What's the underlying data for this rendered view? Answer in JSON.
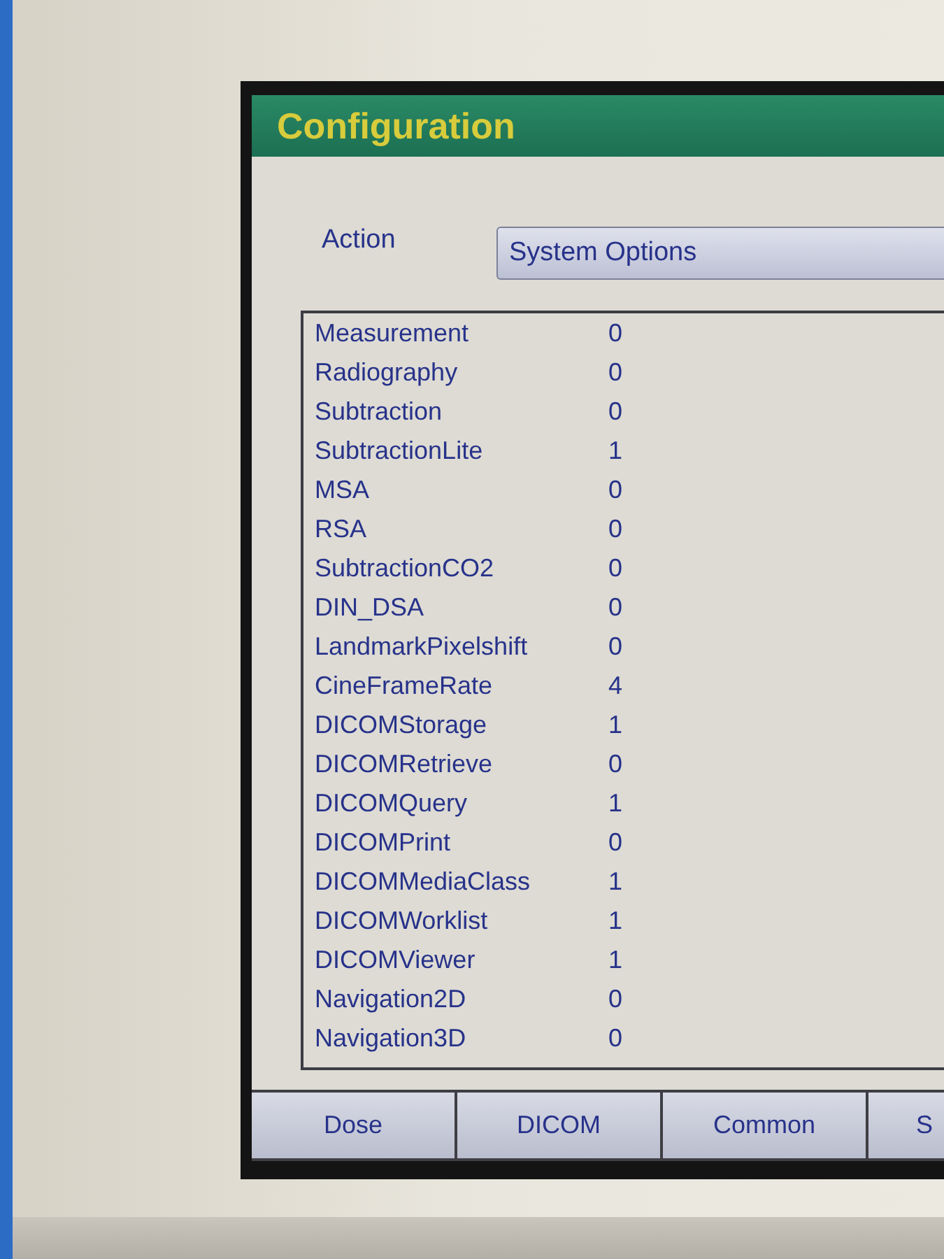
{
  "screen": {
    "title": "Configuration",
    "action": {
      "label": "Action",
      "value": "System Options"
    },
    "options": [
      {
        "name": "Measurement",
        "value": "0"
      },
      {
        "name": "Radiography",
        "value": "0"
      },
      {
        "name": "Subtraction",
        "value": "0"
      },
      {
        "name": "SubtractionLite",
        "value": "1"
      },
      {
        "name": "MSA",
        "value": "0"
      },
      {
        "name": "RSA",
        "value": "0"
      },
      {
        "name": "SubtractionCO2",
        "value": "0"
      },
      {
        "name": "DIN_DSA",
        "value": "0"
      },
      {
        "name": "LandmarkPixelshift",
        "value": "0"
      },
      {
        "name": "CineFrameRate",
        "value": "4"
      },
      {
        "name": "DICOMStorage",
        "value": "1"
      },
      {
        "name": "DICOMRetrieve",
        "value": "0"
      },
      {
        "name": "DICOMQuery",
        "value": "1"
      },
      {
        "name": "DICOMPrint",
        "value": "0"
      },
      {
        "name": "DICOMMediaClass",
        "value": "1"
      },
      {
        "name": "DICOMWorklist",
        "value": "1"
      },
      {
        "name": "DICOMViewer",
        "value": "1"
      },
      {
        "name": "Navigation2D",
        "value": "0"
      },
      {
        "name": "Navigation3D",
        "value": "0"
      }
    ],
    "buttons": [
      {
        "label": "Dose"
      },
      {
        "label": "DICOM"
      },
      {
        "label": "Common"
      },
      {
        "label": "S"
      }
    ]
  }
}
